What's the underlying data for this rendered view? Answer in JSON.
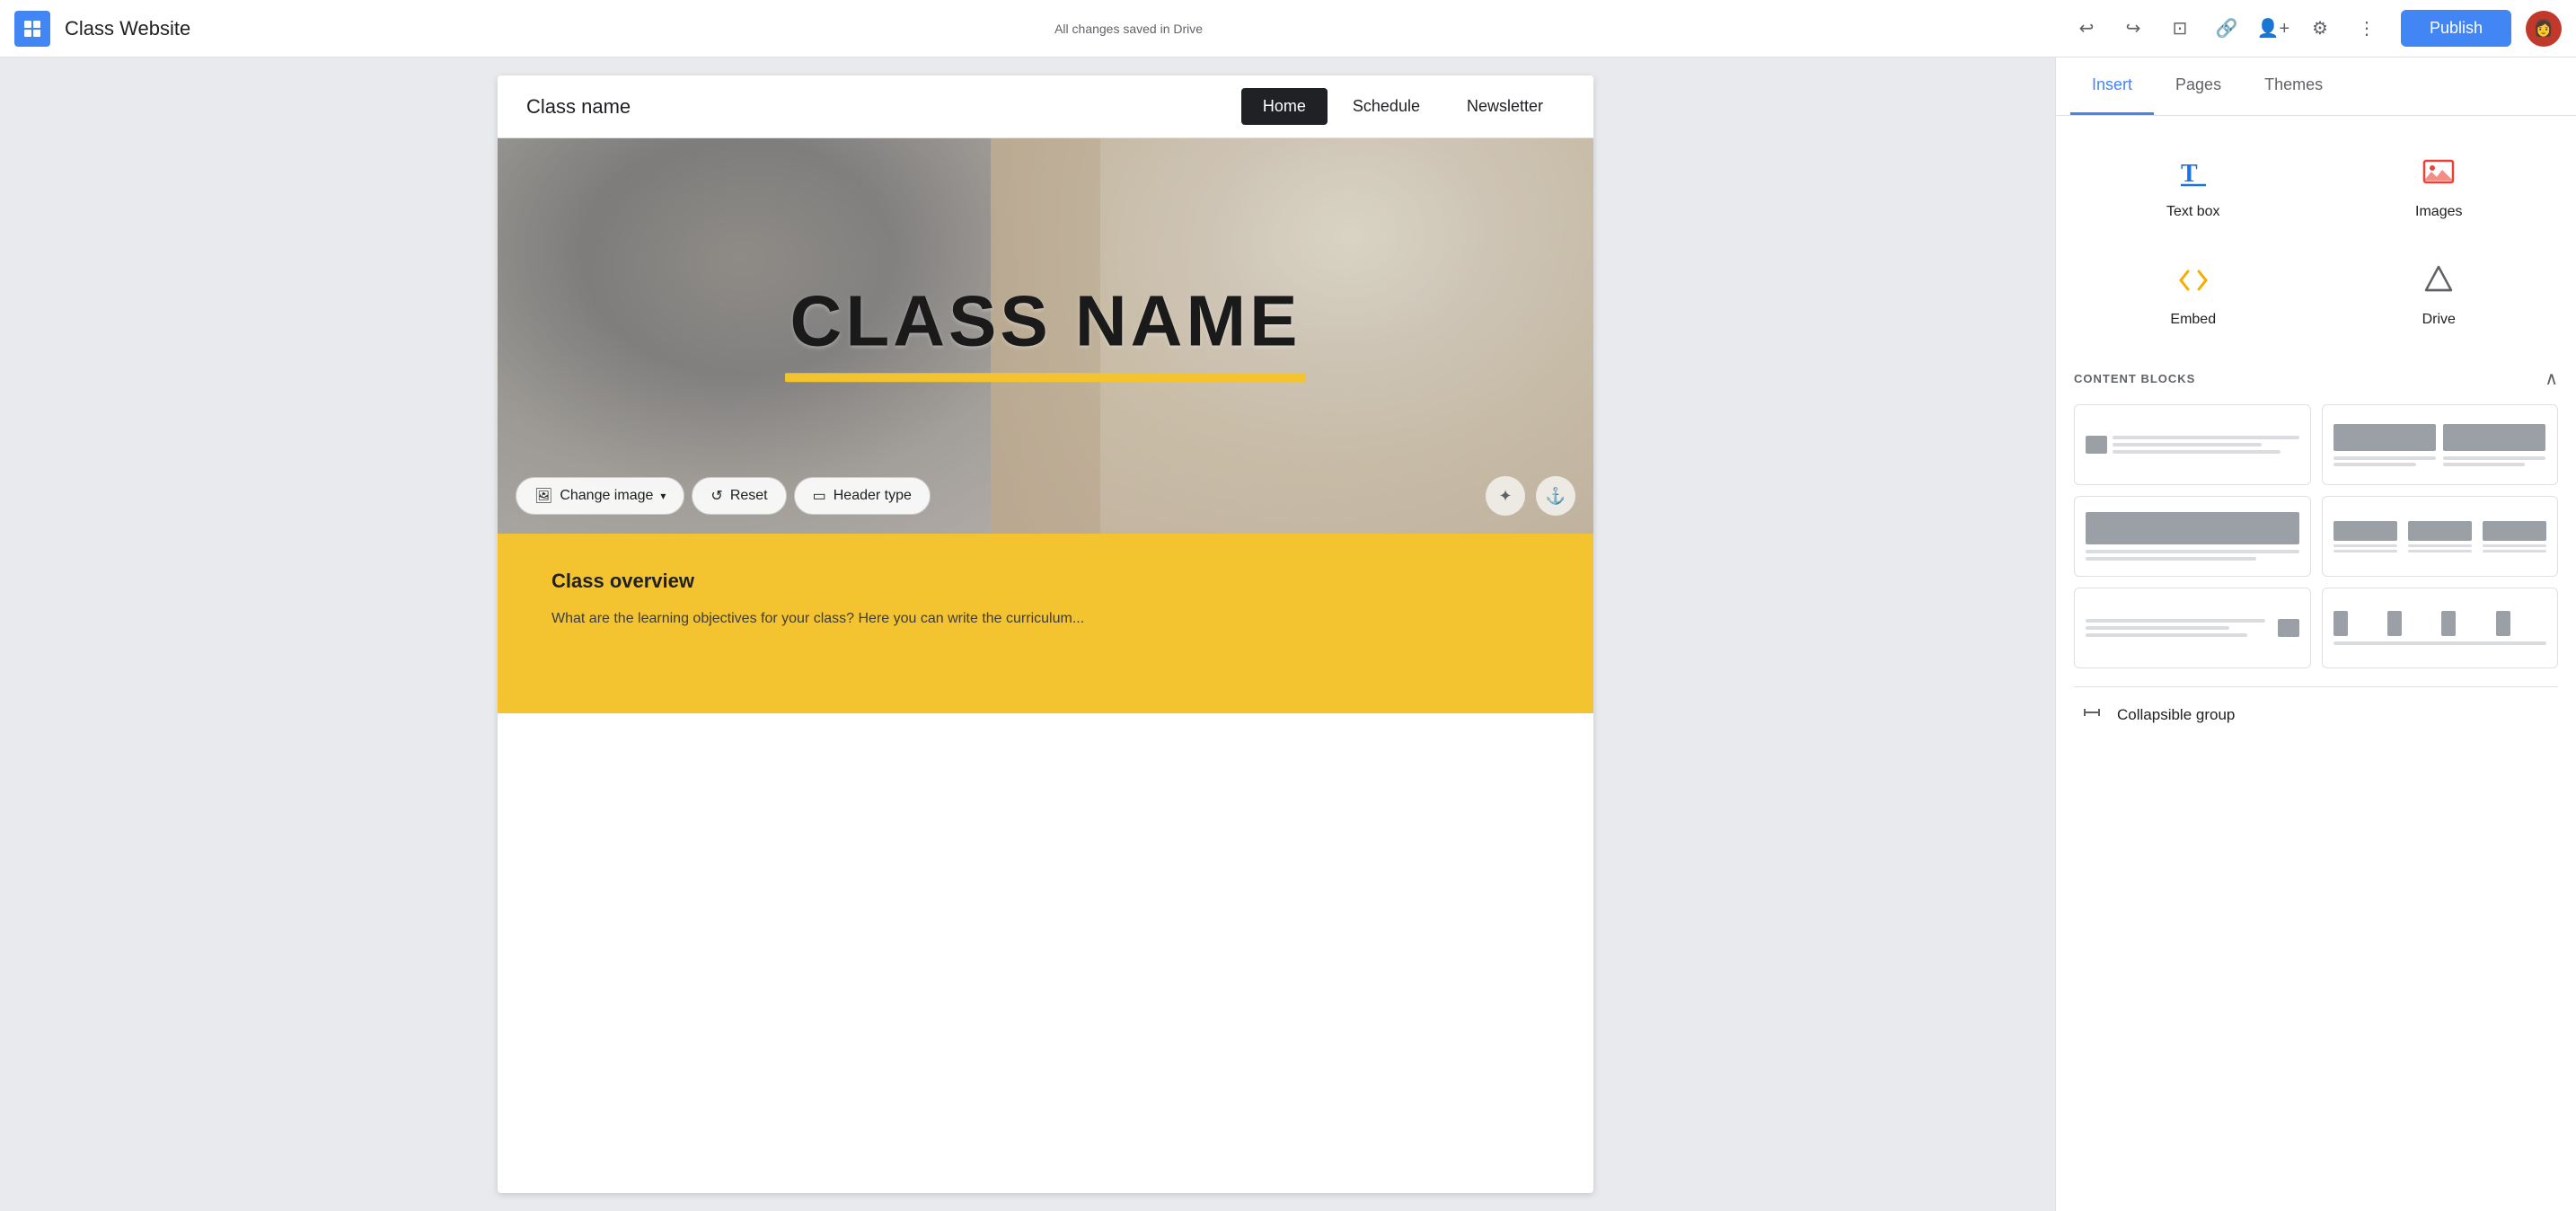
{
  "topbar": {
    "title": "Class Website",
    "status": "All changes saved in Drive",
    "publish_label": "Publish"
  },
  "site_header": {
    "name": "Class name",
    "nav_items": [
      "Home",
      "Schedule",
      "Newsletter"
    ],
    "active_nav": "Home"
  },
  "hero": {
    "title": "CLASS NAME",
    "change_image_label": "Change image",
    "reset_label": "Reset",
    "header_type_label": "Header type"
  },
  "yellow_section": {
    "overview_title": "Class overview",
    "overview_text": "What are the learning objectives for your class? Here you can write the curriculum..."
  },
  "right_panel": {
    "tabs": [
      "Insert",
      "Pages",
      "Themes"
    ],
    "active_tab": "Insert"
  },
  "insert": {
    "items": [
      {
        "label": "Text box",
        "icon_type": "text"
      },
      {
        "label": "Images",
        "icon_type": "image"
      },
      {
        "label": "Embed",
        "icon_type": "embed"
      },
      {
        "label": "Drive",
        "icon_type": "drive"
      }
    ],
    "content_blocks_label": "CONTENT BLOCKS",
    "collapsible_label": "Collapsible group"
  }
}
